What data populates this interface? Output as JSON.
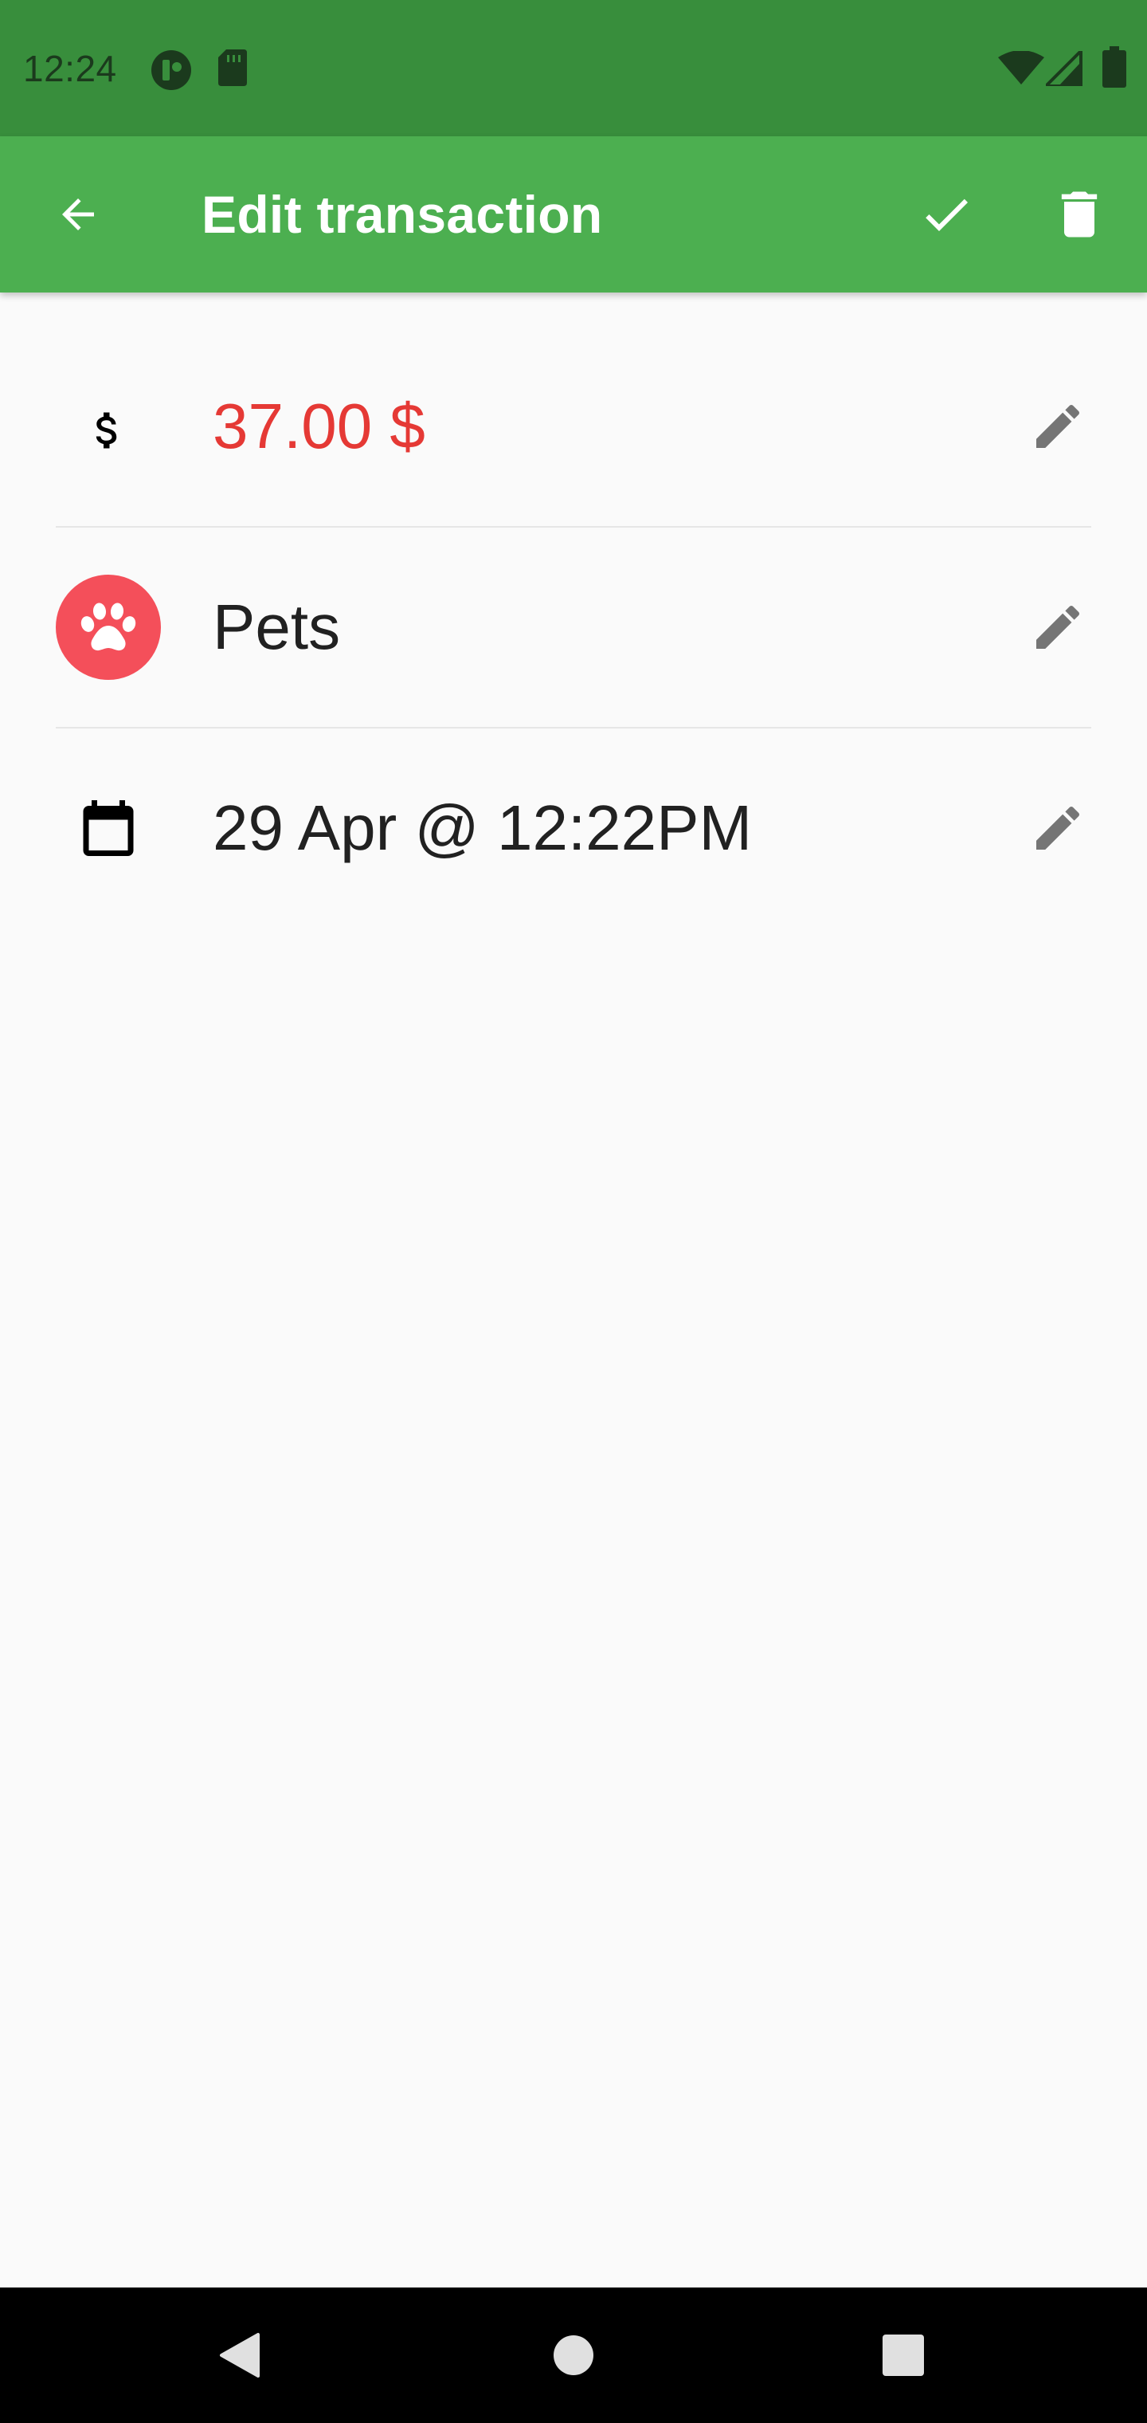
{
  "status_bar": {
    "time": "12:24",
    "left_icons": [
      "app-notification-icon",
      "sd-card-icon"
    ],
    "right_icons": [
      "wifi-icon",
      "cell-signal-icon",
      "battery-icon"
    ],
    "color": "#388e3c"
  },
  "app_bar": {
    "title": "Edit transaction",
    "back_icon": "arrow-back-icon",
    "save_icon": "check-icon",
    "delete_icon": "trash-icon",
    "color": "#4caf50"
  },
  "transaction": {
    "amount": "37.00 $",
    "amount_color": "#e53935",
    "amount_icon": "dollar-icon",
    "category": "Pets",
    "category_icon": "paw-icon",
    "category_color": "#f44f5a",
    "datetime": "29 Apr @ 12:22PM",
    "datetime_icon": "calendar-icon",
    "edit_icon": "pencil-icon"
  },
  "nav_bar": {
    "back_icon": "nav-back-icon",
    "home_icon": "nav-home-icon",
    "recents_icon": "nav-recents-icon"
  }
}
